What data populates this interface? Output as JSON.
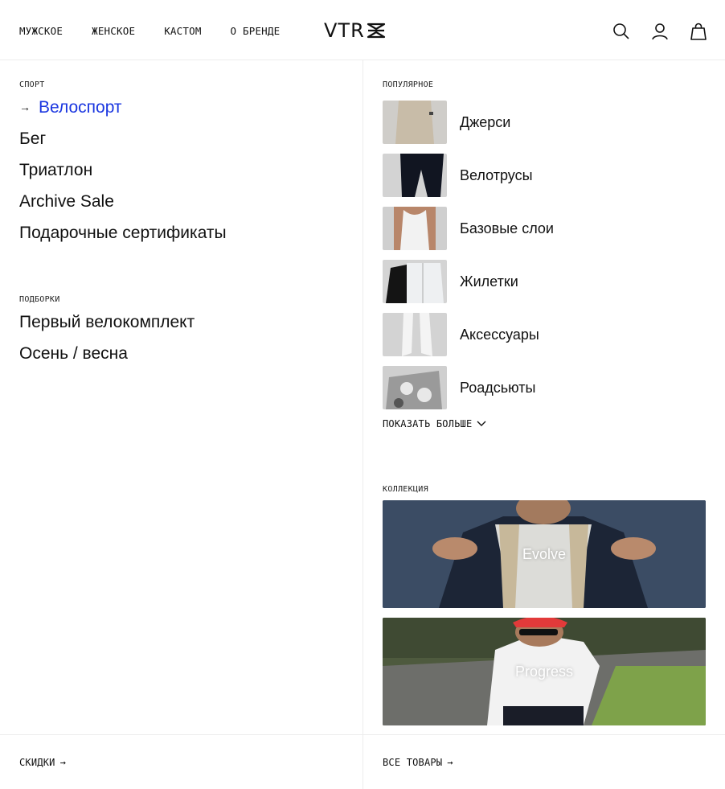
{
  "header": {
    "nav": [
      "МУЖСКОЕ",
      "ЖЕНСКОЕ",
      "КАСТОМ",
      "О БРЕНДЕ"
    ],
    "logo": "VTR",
    "icons": [
      "search-icon",
      "account-icon",
      "cart-icon"
    ]
  },
  "left": {
    "sport_label": "СПОРТ",
    "sport_items": [
      "Велоспорт",
      "Бег",
      "Триатлон",
      "Archive Sale",
      "Подарочные сертификаты"
    ],
    "active_arrow": "→",
    "collections_label": "ПОДБОРКИ",
    "collection_items": [
      "Первый велокомплект",
      "Осень / весна"
    ]
  },
  "right": {
    "popular_label": "ПОПУЛЯРНОЕ",
    "popular_items": [
      "Джерси",
      "Велотрусы",
      "Базовые слои",
      "Жилетки",
      "Аксессуары",
      "Роадсьюты"
    ],
    "show_more": "ПОКАЗАТЬ БОЛЬШЕ",
    "collection_label": "КОЛЛЕКЦИЯ",
    "collection_cards": [
      "Evolve",
      "Progress"
    ]
  },
  "footer": {
    "sale_link": "СКИДКИ",
    "all_products_link": "ВСЕ ТОВАРЫ",
    "arrow": "→"
  },
  "colors": {
    "accent": "#1a36e0",
    "text": "#111111",
    "divider": "#ececec"
  }
}
